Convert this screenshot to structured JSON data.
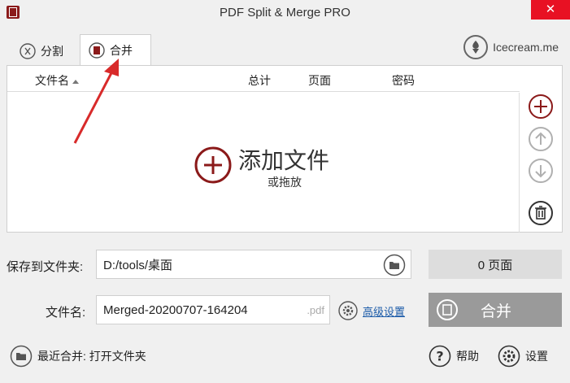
{
  "window": {
    "title": "PDF Split & Merge PRO",
    "close_glyph": "✕"
  },
  "tabs": [
    {
      "label": "分割",
      "icon": "scissors-icon"
    },
    {
      "label": "合并",
      "icon": "book-icon"
    }
  ],
  "brand": {
    "label": "Icecream.me"
  },
  "table": {
    "columns": {
      "name": "文件名",
      "total": "总计",
      "pages": "页面",
      "password": "密码"
    },
    "sort": "ascending"
  },
  "drop_zone": {
    "title": "添加文件",
    "subtitle": "或拖放"
  },
  "save": {
    "label": "保存到文件夹:",
    "path": "D:/tools/桌面"
  },
  "file": {
    "label": "文件名:",
    "value": "Merged-20200707-164204",
    "ext": ".pdf"
  },
  "advanced": {
    "label": "高级设置"
  },
  "pages_count": "0 页面",
  "merge_button": {
    "label": "合并"
  },
  "footer": {
    "recent": "最近合并: 打开文件夹",
    "help": "帮助",
    "settings": "设置"
  },
  "colors": {
    "accent": "#8b1a1a",
    "disabled": "#b0b0b0",
    "link": "#1a5aa8",
    "merge_btn": "#9a9a9a"
  }
}
